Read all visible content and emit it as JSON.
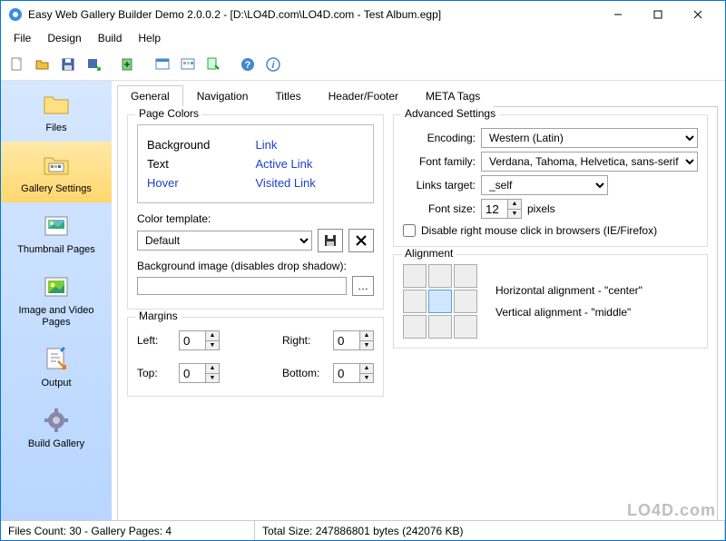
{
  "window": {
    "title": "Easy Web Gallery Builder Demo 2.0.0.2 - [D:\\LO4D.com\\LO4D.com - Test Album.egp]"
  },
  "menu": {
    "file": "File",
    "design": "Design",
    "build": "Build",
    "help": "Help"
  },
  "sidebar": {
    "items": [
      {
        "label": "Files"
      },
      {
        "label": "Gallery Settings"
      },
      {
        "label": "Thumbnail Pages"
      },
      {
        "label": "Image and Video Pages"
      },
      {
        "label": "Output"
      },
      {
        "label": "Build Gallery"
      }
    ]
  },
  "tabs": {
    "general": "General",
    "navigation": "Navigation",
    "titles": "Titles",
    "header": "Header/Footer",
    "meta": "META Tags"
  },
  "pageColors": {
    "title": "Page Colors",
    "background": "Background",
    "link": "Link",
    "text": "Text",
    "activeLink": "Active Link",
    "hover": "Hover",
    "visitedLink": "Visited Link"
  },
  "colorTemplate": {
    "label": "Color template:",
    "value": "Default"
  },
  "bgImage": {
    "label": "Background image (disables drop shadow):",
    "value": ""
  },
  "margins": {
    "title": "Margins",
    "leftLabel": "Left:",
    "leftVal": "0",
    "rightLabel": "Right:",
    "rightVal": "0",
    "topLabel": "Top:",
    "topVal": "0",
    "bottomLabel": "Bottom:",
    "bottomVal": "0"
  },
  "advanced": {
    "title": "Advanced Settings",
    "encodingLabel": "Encoding:",
    "encodingVal": "Western (Latin)",
    "fontFamilyLabel": "Font family:",
    "fontFamilyVal": "Verdana, Tahoma, Helvetica, sans-serif",
    "linksTargetLabel": "Links target:",
    "linksTargetVal": "_self",
    "fontSizeLabel": "Font size:",
    "fontSizeVal": "12",
    "fontSizeUnit": "pixels",
    "disableRightLabel": "Disable right mouse click in browsers (IE/Firefox)"
  },
  "alignment": {
    "title": "Alignment",
    "horizLabel": "Horizontal alignment - \"center\"",
    "vertLabel": "Vertical alignment - \"middle\""
  },
  "status": {
    "filesCount": "Files Count: 30 - Gallery Pages: 4",
    "totalSize": "Total Size: 247886801 bytes (242076 KB)"
  },
  "watermark": "LO4D.com"
}
